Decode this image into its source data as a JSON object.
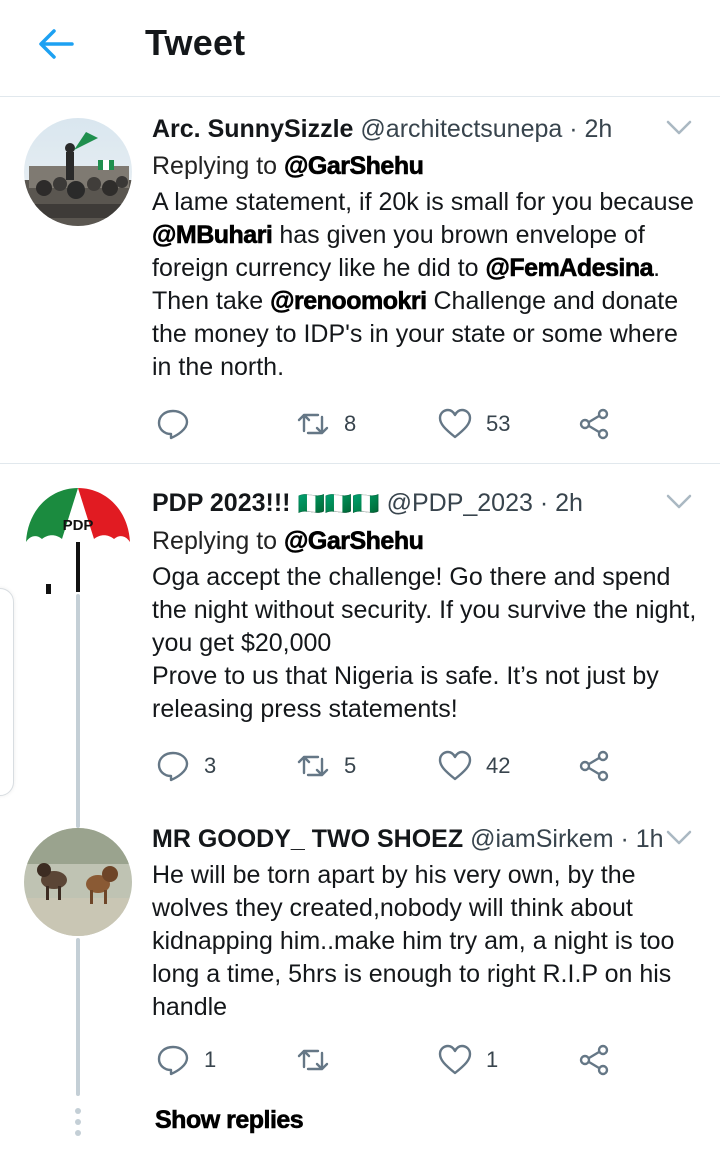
{
  "header": {
    "title": "Tweet"
  },
  "tweets": [
    {
      "name": "Arc. SunnySizzle",
      "handle": "@architectsunepa",
      "sep": "·",
      "time": "2h",
      "replying_prefix": "Replying to",
      "replying_to": "@GarShehu",
      "body": {
        "t1": "A lame statement, if 20k is small for you because",
        "m1": "@MBuhari",
        "t2": " has given you brown envelope of foreign currency like he did to ",
        "m2": "@FemAdesina",
        "t3": ". Then take ",
        "m3": "@renoomokri",
        "t4": " Challenge and donate the money to IDP's in your state or some where in the north."
      },
      "replies": "",
      "retweets": "8",
      "likes": "53"
    },
    {
      "name": "PDP 2023!!!",
      "flags": "🇳🇬🇳🇬🇳🇬",
      "handle": "@PDP_2023",
      "sep": "·",
      "time": "2h",
      "avatar_text": "PDP",
      "replying_prefix": "Replying to",
      "replying_to": "@GarShehu",
      "body": {
        "l1": "Oga accept the challenge! Go there and spend the night without security. If you survive the night, you get $20,000",
        "l2": "Prove to us that Nigeria is safe. It’s not just by releasing press statements!"
      },
      "replies": "3",
      "retweets": "5",
      "likes": "42"
    },
    {
      "name": "MR GOODY_ TWO SHOEZ",
      "handle": "@iamSirkem",
      "sep": "·",
      "time": "1h",
      "body": {
        "l1": "He will be torn apart by his very own, by the wolves they created,nobody will think about kidnapping him..make him try am, a night is too long a time, 5hrs is enough to right R.I.P on his handle"
      },
      "replies": "1",
      "retweets": "",
      "likes": "1"
    }
  ],
  "show_replies": "Show replies",
  "colors": {
    "accent": "#1da1f2",
    "icon": "#657786",
    "divider": "#e1e8ed",
    "thread": "#c4cfd6"
  }
}
